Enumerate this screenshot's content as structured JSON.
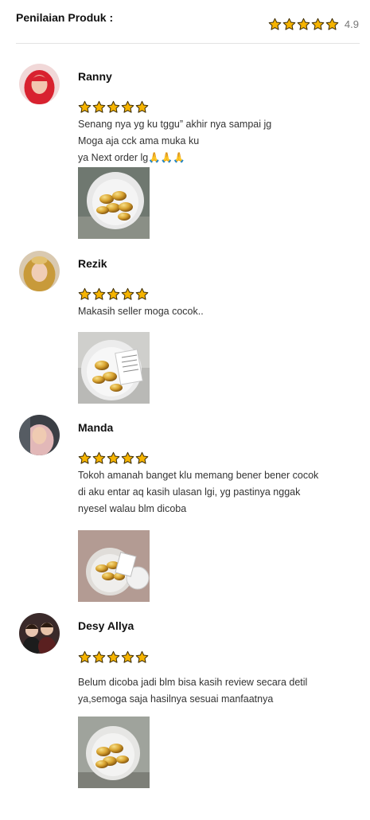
{
  "header": {
    "title": "Penilaian Produk :",
    "score": "4.9",
    "stars": 5
  },
  "colors": {
    "star_fill": "#f6b400",
    "star_outline": "#3a2a00",
    "divider": "#e3e3e3"
  },
  "reviews": [
    {
      "name": "Ranny",
      "stars": 5,
      "lines": [
        "Senang nya yg ku tggu” akhir nya sampai jg",
        "Moga aja cck ama muka ku",
        "ya Next order lg🙏🙏🙏"
      ],
      "avatar_icon": "hijab-avatar-red",
      "photo_icon": "capsule-jar-photo"
    },
    {
      "name": "Rezik",
      "stars": 5,
      "lines": [
        "Makasih seller moga cocok.."
      ],
      "avatar_icon": "hijab-avatar-gold",
      "photo_icon": "capsule-jar-photo"
    },
    {
      "name": "Manda",
      "stars": 5,
      "lines": [
        "Tokoh amanah banget klu memang bener bener cocok",
        "di aku entar aq kasih ulasan lgi, yg pastinya nggak",
        "nyesel walau blm dicoba"
      ],
      "avatar_icon": "hijab-avatar-pink",
      "photo_icon": "capsule-jar-photo"
    },
    {
      "name": "Desy Allya",
      "stars": 5,
      "lines": [
        "Belum dicoba jadi blm bisa kasih review secara detil",
        "ya,semoga saja hasilnya sesuai manfaatnya"
      ],
      "avatar_icon": "group-avatar",
      "photo_icon": "capsule-jar-photo"
    }
  ]
}
